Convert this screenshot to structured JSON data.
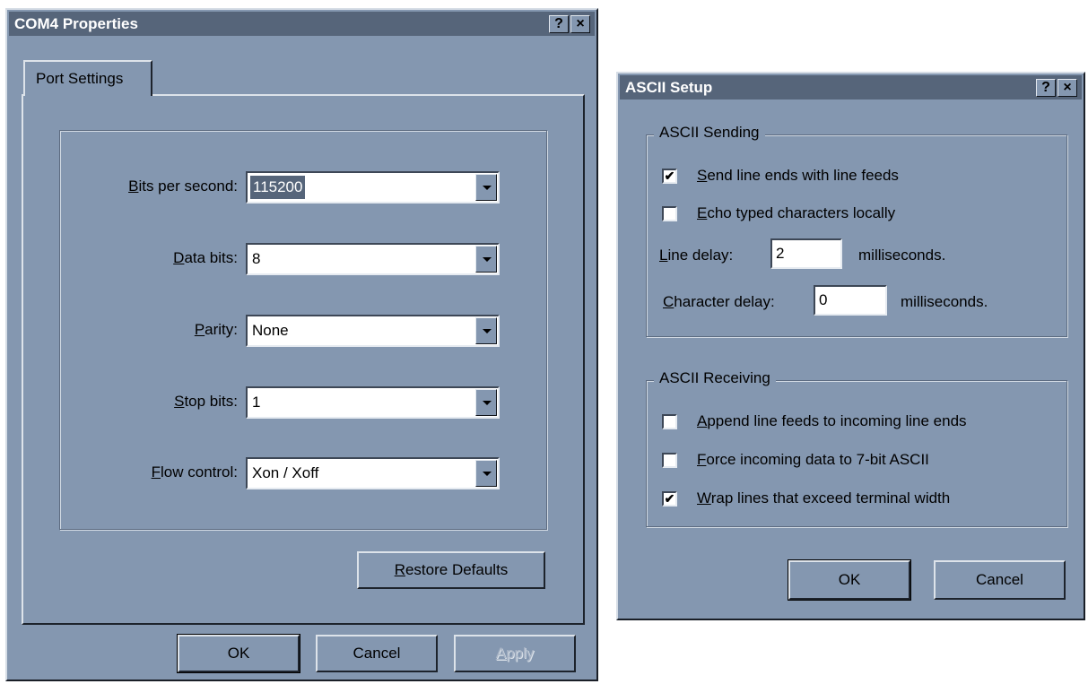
{
  "com4": {
    "title": "COM4 Properties",
    "help_glyph": "?",
    "close_glyph": "×",
    "tab_label": "Port Settings",
    "fields": {
      "bits_per_second": {
        "accel": "B",
        "rest": "its per second:",
        "value": "115200"
      },
      "data_bits": {
        "accel": "D",
        "rest": "ata bits:",
        "value": "8"
      },
      "parity": {
        "accel": "P",
        "rest": "arity:",
        "value": "None"
      },
      "stop_bits": {
        "accel": "S",
        "rest": "top bits:",
        "value": "1"
      },
      "flow_control": {
        "accel": "F",
        "rest": "low control:",
        "value": "Xon / Xoff"
      }
    },
    "restore_defaults": {
      "accel": "R",
      "rest": "estore Defaults"
    },
    "ok_label": "OK",
    "cancel_label": "Cancel",
    "apply": {
      "accel": "A",
      "rest": "pply"
    }
  },
  "ascii": {
    "title": "ASCII Setup",
    "help_glyph": "?",
    "close_glyph": "×",
    "sending": {
      "legend": "ASCII Sending",
      "send_line_ends": {
        "checked": true,
        "mark": "✔",
        "accel": "S",
        "rest": "end line ends with line feeds"
      },
      "echo_typed": {
        "checked": false,
        "mark": "",
        "accel": "E",
        "rest": "cho typed characters locally"
      },
      "line_delay": {
        "accel": "L",
        "rest": "ine delay:",
        "value": "2",
        "unit": "milliseconds."
      },
      "char_delay": {
        "accel": "C",
        "rest": "haracter delay:",
        "value": "0",
        "unit": "milliseconds."
      }
    },
    "receiving": {
      "legend": "ASCII Receiving",
      "append_line_feeds": {
        "checked": false,
        "mark": "",
        "accel": "A",
        "rest": "ppend line feeds to incoming line ends"
      },
      "force_7bit": {
        "checked": false,
        "mark": "",
        "accel": "F",
        "rest": "orce incoming data to 7-bit ASCII"
      },
      "wrap_lines": {
        "checked": true,
        "mark": "✔",
        "accel": "W",
        "rest": "rap lines that exceed terminal width"
      }
    },
    "ok_label": "OK",
    "cancel_label": "Cancel"
  }
}
